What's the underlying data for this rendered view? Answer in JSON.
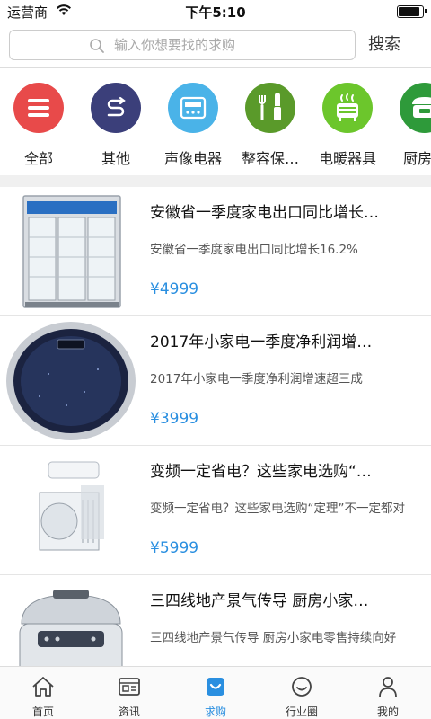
{
  "status_bar": {
    "carrier": "运营商",
    "time": "下午5:10",
    "battery_level": 0.92
  },
  "search": {
    "placeholder": "输入你想要找的求购",
    "value": "",
    "button_label": "搜索"
  },
  "categories": [
    {
      "label": "全部",
      "color": "#e84a4a",
      "icon": "menu-icon"
    },
    {
      "label": "其他",
      "color": "#3b3f7a",
      "icon": "route-icon"
    },
    {
      "label": "声像电器",
      "color": "#4ab3e8",
      "icon": "audio-device-icon"
    },
    {
      "label": "整容保…",
      "color": "#5a9a2a",
      "icon": "beauty-tools-icon"
    },
    {
      "label": "电暖器具",
      "color": "#6cc62c",
      "icon": "heater-icon"
    },
    {
      "label": "厨房电",
      "color": "#2e9a3a",
      "icon": "rice-cooker-icon"
    }
  ],
  "products": [
    {
      "title": "安徽省一季度家电出口同比增长…",
      "desc": "安徽省一季度家电出口同比增长16.2%",
      "price": "¥4999",
      "image": "display-fridge-image"
    },
    {
      "title": "2017年小家电一季度净利润增…",
      "desc": "2017年小家电一季度净利润增速超三成",
      "price": "¥3999",
      "image": "robot-vacuum-image"
    },
    {
      "title": "变频一定省电？这些家电选购“…",
      "desc": "变频一定省电？这些家电选购“定理”不一定都对",
      "price": "¥5999",
      "image": "air-conditioner-image"
    },
    {
      "title": "三四线地产景气传导 厨房小家…",
      "desc": "三四线地产景气传导 厨房小家电零售持续向好",
      "price": "",
      "image": "rice-cooker-image"
    }
  ],
  "tabs": [
    {
      "label": "首页",
      "icon": "home-icon",
      "active": false
    },
    {
      "label": "资讯",
      "icon": "news-icon",
      "active": false
    },
    {
      "label": "求购",
      "icon": "purchase-icon",
      "active": true
    },
    {
      "label": "行业圈",
      "icon": "circle-icon",
      "active": false
    },
    {
      "label": "我的",
      "icon": "user-icon",
      "active": false
    }
  ],
  "colors": {
    "accent": "#2a8fe0",
    "divider": "#e5e5e5"
  }
}
